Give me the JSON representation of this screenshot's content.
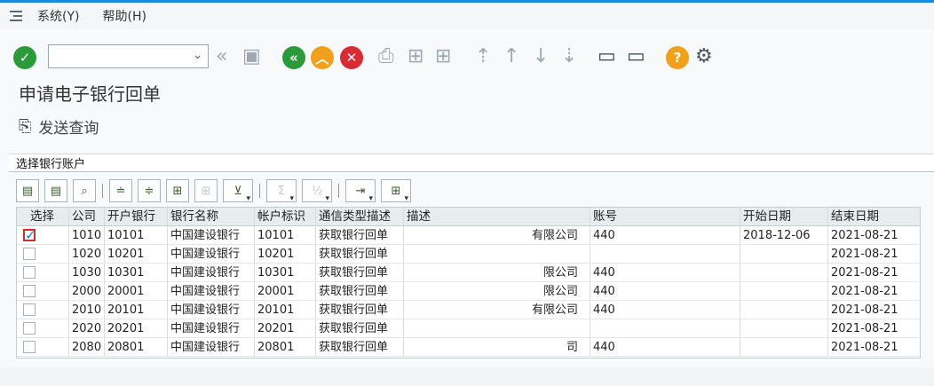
{
  "menubar": {
    "items": [
      "系统(Y)",
      "帮助(H)"
    ]
  },
  "toolbar": {
    "command_value": "",
    "icons": [
      "enter-icon",
      "save-icon",
      "back-icon",
      "exit-icon",
      "cancel-icon",
      "print-icon",
      "find-icon",
      "find-next-icon",
      "first-page-icon",
      "prev-page-icon",
      "next-page-icon",
      "last-page-icon",
      "create-session-icon",
      "shortcut-icon",
      "help-icon",
      "settings-icon"
    ]
  },
  "page": {
    "title": "申请电子银行回单",
    "action_label": "发送查询",
    "section_label": "选择银行账户"
  },
  "table": {
    "headers": [
      "选择",
      "公司",
      "开户银行",
      "银行名称",
      "帐户标识",
      "通信类型描述",
      "描述",
      "账号",
      "开始日期",
      "结束日期"
    ],
    "rows": [
      {
        "checked": true,
        "company": "1010",
        "bank": "10101",
        "bank_name": "中国建设银行",
        "account_id": "10101",
        "comm_type": "获取银行回单",
        "desc": "有限公司",
        "account_no": "440",
        "start": "2018-12-06",
        "end": "2021-08-21"
      },
      {
        "checked": false,
        "company": "1020",
        "bank": "10201",
        "bank_name": "中国建设银行",
        "account_id": "10201",
        "comm_type": "获取银行回单",
        "desc": "",
        "account_no": "",
        "start": "",
        "end": "2021-08-21"
      },
      {
        "checked": false,
        "company": "1030",
        "bank": "10301",
        "bank_name": "中国建设银行",
        "account_id": "10301",
        "comm_type": "获取银行回单",
        "desc": "限公司",
        "account_no": "440",
        "start": "",
        "end": "2021-08-21"
      },
      {
        "checked": false,
        "company": "2000",
        "bank": "20001",
        "bank_name": "中国建设银行",
        "account_id": "20001",
        "comm_type": "获取银行回单",
        "desc": "限公司",
        "account_no": "440",
        "start": "",
        "end": "2021-08-21"
      },
      {
        "checked": false,
        "company": "2010",
        "bank": "20101",
        "bank_name": "中国建设银行",
        "account_id": "20101",
        "comm_type": "获取银行回单",
        "desc": "有限公司",
        "account_no": "440",
        "start": "",
        "end": "2021-08-21"
      },
      {
        "checked": false,
        "company": "2020",
        "bank": "20201",
        "bank_name": "中国建设银行",
        "account_id": "20201",
        "comm_type": "获取银行回单",
        "desc": "",
        "account_no": "",
        "start": "",
        "end": "2021-08-21"
      },
      {
        "checked": false,
        "company": "2080",
        "bank": "20801",
        "bank_name": "中国建设银行",
        "account_id": "20801",
        "comm_type": "获取银行回单",
        "desc": "司",
        "account_no": "440",
        "start": "",
        "end": "2021-08-21"
      }
    ]
  },
  "colors": {
    "accent": "#1f8ad2",
    "ok_green": "#2a9a3a",
    "warn_orange": "#f0a01c",
    "cancel_red": "#d82a34"
  }
}
